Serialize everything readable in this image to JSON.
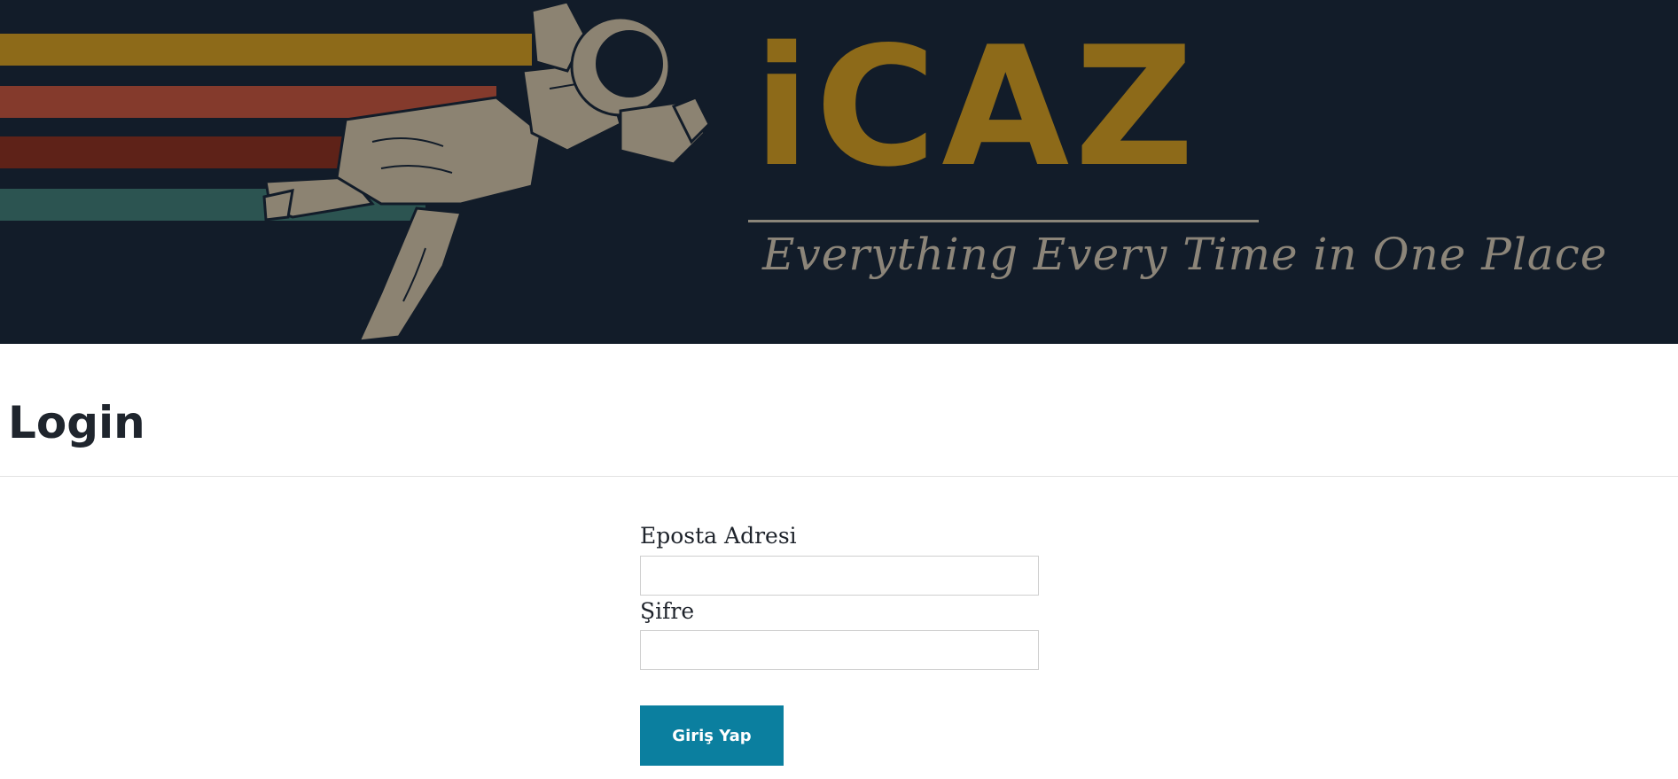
{
  "banner": {
    "logo_text": "iCAZ",
    "tagline": "Everything Every Time in One Place",
    "colors": {
      "background": "#121c29",
      "stripe_gold": "#8d6a19",
      "stripe_orange": "#843a2c",
      "stripe_red": "#5e2218",
      "stripe_teal": "#2c5451",
      "logo_gold": "#8d6a19",
      "tagline": "#8c8579"
    },
    "illustration": "astronaut"
  },
  "page": {
    "title": "Login"
  },
  "form": {
    "email_label": "Eposta Adresi",
    "email_value": "",
    "password_label": "Şifre",
    "password_value": "",
    "submit_label": "Giriş Yap",
    "submit_color": "#0b7f9f"
  }
}
